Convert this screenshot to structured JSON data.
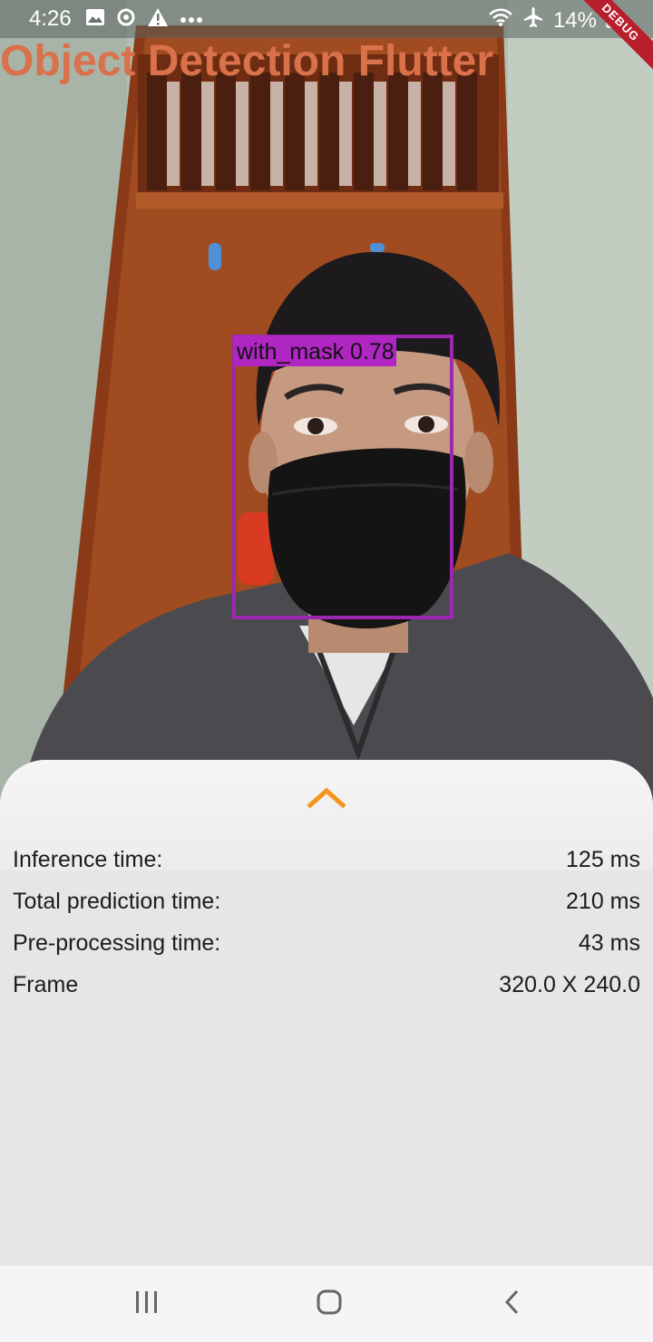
{
  "status_bar": {
    "time": "4:26",
    "battery": "14%",
    "left_icons": [
      "image-icon",
      "sync-icon",
      "warning-icon",
      "more-dots-icon"
    ],
    "right_icons": [
      "wifi-icon",
      "airplane-icon",
      "battery-icon"
    ]
  },
  "app": {
    "title": "Object Detection Flutter",
    "title_color": "#d9714a",
    "debug_banner": "DEBUG"
  },
  "detection": {
    "label": "with_mask 0.78",
    "box_color": "#9c27b0"
  },
  "sheet": {
    "expand_icon": "chevron-up-icon",
    "accent": "#f7941d",
    "stats": [
      {
        "label": "Inference time:",
        "value": "125 ms"
      },
      {
        "label": "Total prediction time:",
        "value": "210 ms"
      },
      {
        "label": "Pre-processing time:",
        "value": "43 ms"
      },
      {
        "label": "Frame",
        "value": "320.0 X 240.0"
      }
    ]
  },
  "nav_bar": {
    "buttons": [
      "recents-icon",
      "home-icon",
      "back-icon"
    ]
  }
}
